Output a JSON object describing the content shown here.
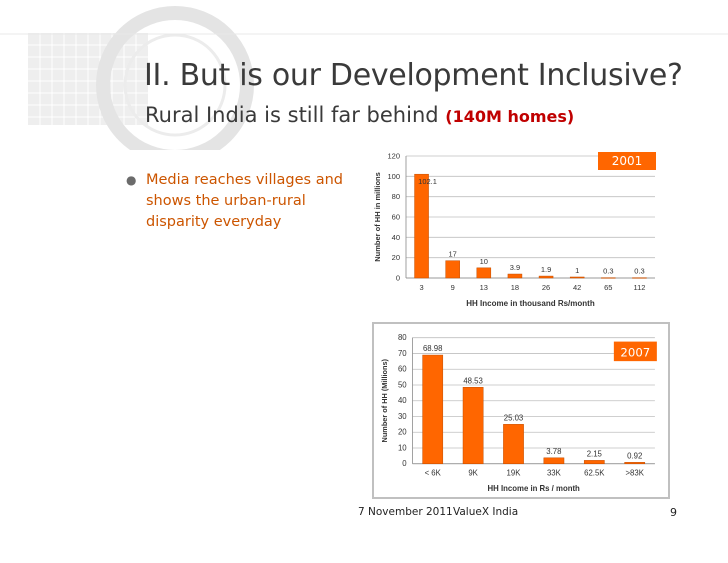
{
  "slide": {
    "title": "II. But is our Development Inclusive?",
    "subtitle": "Rural India is still far behind",
    "subtitle_highlight": "(140M homes)",
    "bullet": "Media reaches villages and shows the urban-rural disparity everyday",
    "footer_date": "7 November 2011",
    "footer_org": "ValueX India",
    "page_number": "9"
  },
  "colors": {
    "bar": "#ff6600",
    "badge": "#ff6600",
    "accent": "#c00000"
  },
  "chart_data": [
    {
      "type": "bar",
      "title": "",
      "badge": "2001",
      "xlabel": "HH Income in thousand Rs/month",
      "ylabel": "Number of HH in millions",
      "categories": [
        "3",
        "9",
        "13",
        "18",
        "26",
        "42",
        "65",
        "112"
      ],
      "values": [
        102.1,
        17,
        10,
        3.9,
        1.9,
        1,
        0.3,
        0.3
      ],
      "value_labels": [
        "102.1",
        "17",
        "10",
        "3.9",
        "1.9",
        "1",
        "0.3",
        "0.3"
      ],
      "ylim": [
        0,
        120
      ],
      "yticks": [
        "0",
        "20",
        "40",
        "60",
        "80",
        "100",
        "120"
      ],
      "grid": true
    },
    {
      "type": "bar",
      "title": "",
      "badge": "2007",
      "xlabel": "HH Income in Rs / month",
      "ylabel": "Number of HH (Millions)",
      "categories": [
        "< 6K",
        "9K",
        "19K",
        "33K",
        "62.5K",
        ">83K"
      ],
      "values": [
        68.98,
        48.53,
        25.03,
        3.78,
        2.15,
        0.92
      ],
      "value_labels": [
        "68.98",
        "48.53",
        "25.03",
        "3.78",
        "2.15",
        "0.92"
      ],
      "ylim": [
        0,
        80
      ],
      "yticks": [
        "0",
        "10",
        "20",
        "30",
        "40",
        "50",
        "60",
        "70",
        "80"
      ],
      "grid": true
    }
  ]
}
